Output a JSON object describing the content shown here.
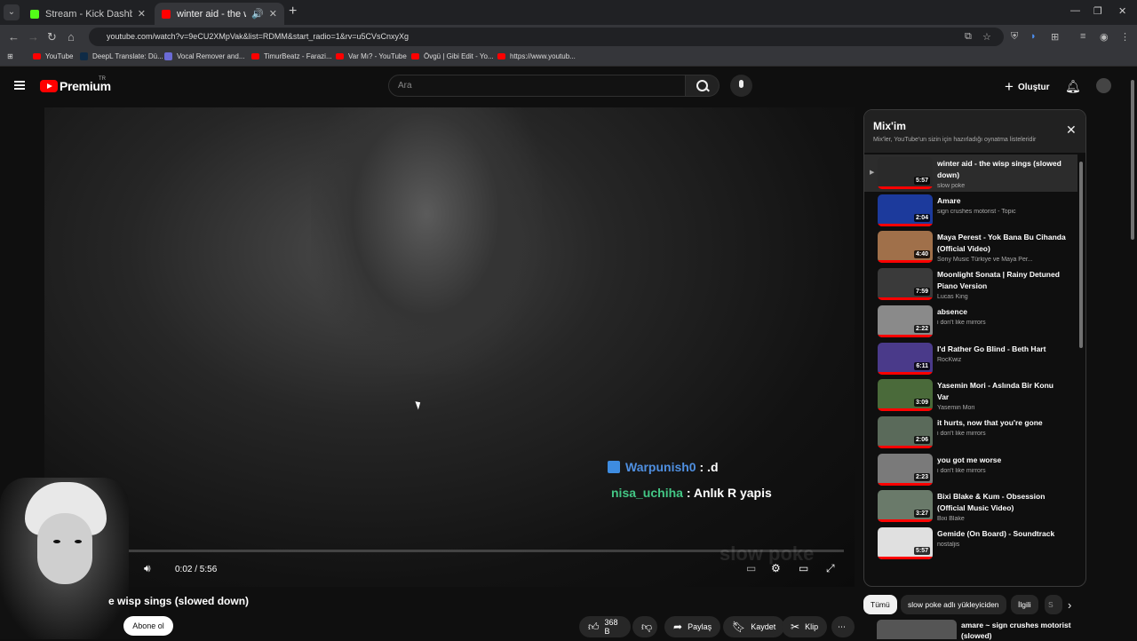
{
  "browser": {
    "tabs": [
      {
        "label": "Stream - Kick Dashboard",
        "favicon_color": "#53fc18"
      },
      {
        "label": "winter aid - the wisp sings (",
        "favicon_color": "#ff0000"
      }
    ],
    "url": "youtube.com/watch?v=9eCU2XMpVak&list=RDMM&start_radio=1&rv=u5CVsCnxyXg",
    "bookmarks": [
      "YouTube",
      "DeepL Translate: Dü...",
      "Vocal Remover and...",
      "TimurBeatz - Farazi...",
      "Var Mı? - YouTube",
      "Övgü | Gibi Edit - Yo...",
      "https://www.youtub..."
    ]
  },
  "yt": {
    "brand": "Premium",
    "region": "TR",
    "search_placeholder": "Ara",
    "create_label": "Oluştur"
  },
  "player": {
    "time": "0:02 / 5:56",
    "progress": 0.006,
    "watermark": "slow poke",
    "chat": [
      {
        "user": "Warpunish0",
        "msg": ": .d",
        "color": "#4f8fe0"
      },
      {
        "user": "nisa_uchiha",
        "msg": ": Anlık R yapis",
        "color": "#43c785"
      }
    ]
  },
  "video": {
    "title": "e wisp sings (slowed down)",
    "subscribe_label": "Abone ol",
    "likes": "368 B",
    "share_label": "Paylaş",
    "save_label": "Kaydet",
    "clip_label": "Klip"
  },
  "playlist": {
    "title": "Mix'im",
    "subtitle": "Mix'ler, YouTube'un sizin için hazırladığı oynatma listeleridir",
    "items": [
      {
        "title": "winter aid - the wisp sings (slowed down)",
        "channel": "slow poke",
        "duration": "5:57",
        "thumb": "#2a2a2a"
      },
      {
        "title": "Amare",
        "channel": "sign crushes motorist - Topic",
        "duration": "2:04",
        "thumb": "#1c3a9c"
      },
      {
        "title": "Maya Perest - Yok Bana Bu Cihanda (Official Video)",
        "channel": "Sony Music Türkiye ve Maya Per...",
        "duration": "4:40",
        "thumb": "#a0704a"
      },
      {
        "title": "Moonlight Sonata | Rainy Detuned Piano Version",
        "channel": "Lucas King",
        "duration": "7:59",
        "thumb": "#3a3a3a"
      },
      {
        "title": "absence",
        "channel": "i don't like mirrors",
        "duration": "2:22",
        "thumb": "#8a8a8a"
      },
      {
        "title": "I'd Rather Go Blind - Beth Hart",
        "channel": "RocKwiz",
        "duration": "6:11",
        "thumb": "#4a3a8a"
      },
      {
        "title": "Yasemin Mori - Aslında Bir Konu Var",
        "channel": "Yasemin Mori",
        "duration": "3:09",
        "thumb": "#4a6a3a"
      },
      {
        "title": "it hurts, now that you're gone",
        "channel": "i don't like mirrors",
        "duration": "2:06",
        "thumb": "#5a6a5a"
      },
      {
        "title": "you got me worse",
        "channel": "i don't like mirrors",
        "duration": "2:23",
        "thumb": "#7a7a7a"
      },
      {
        "title": "Bixi Blake & Kum - Obsession (Official Music Video)",
        "channel": "Bixi Blake",
        "duration": "3:27",
        "thumb": "#6a7a6a"
      },
      {
        "title": "Gemide (On Board) - Soundtrack",
        "channel": "nostaljis",
        "duration": "5:57",
        "thumb": "#e0e0e0"
      }
    ]
  },
  "chips": [
    "Tümü",
    "slow poke adlı yükleyiciden",
    "İlgili",
    "S"
  ],
  "recommend": {
    "title": "amare ~ sign crushes motorist (slowed)"
  }
}
